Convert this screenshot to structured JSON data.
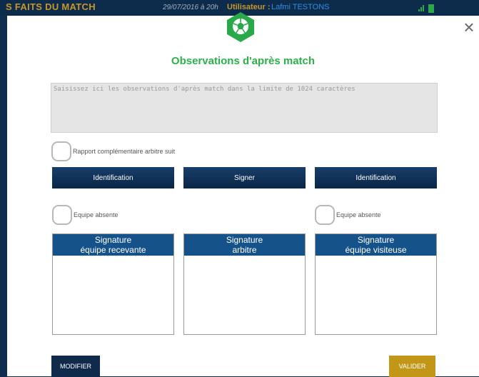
{
  "background_header": {
    "title": "S FAITS DU MATCH",
    "date": "29/07/2016 à 20h",
    "user_label": "Utilisateur :",
    "user_name": "Lafmi TESTONS"
  },
  "modal": {
    "title": "Observations d'après match",
    "close_label": "×",
    "badge_icon": "soccer-ball-icon",
    "observations": {
      "value": "",
      "placeholder": "Saisissez ici les observations d'après match dans la limite de 1024 caractères"
    },
    "rapport_checkbox": {
      "label": "Rapport complémentaire arbitre suit",
      "checked": false
    },
    "buttons": {
      "identification_home": "Identification",
      "signer": "Signer",
      "identification_away": "Identification",
      "modifier": "MODIFIER",
      "valider": "VALIDER"
    },
    "absent_home": {
      "label": "Equipe absente",
      "checked": false
    },
    "absent_away": {
      "label": "Equipe absente",
      "checked": false
    },
    "signatures": [
      {
        "line1": "Signature",
        "line2": "équipe recevante"
      },
      {
        "line1": "Signature",
        "line2": "arbitre"
      },
      {
        "line1": "Signature",
        "line2": "équipe visiteuse"
      }
    ]
  },
  "colors": {
    "title_green": "#2cb14a",
    "navy": "#0b2646",
    "signature_blue": "#15528a",
    "valider_gold": "#c29718",
    "header_gold": "#c9962a"
  }
}
